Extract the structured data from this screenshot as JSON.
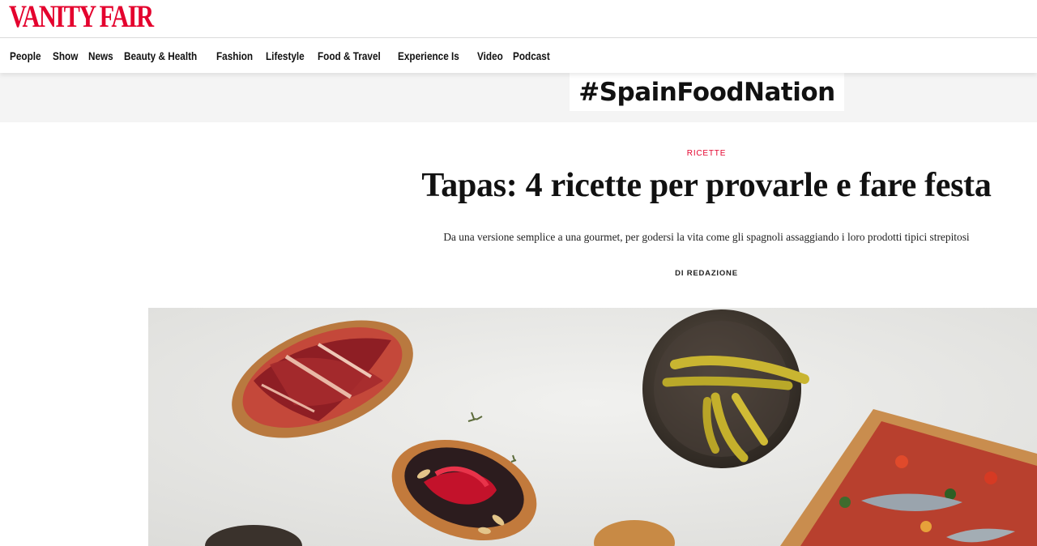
{
  "header": {
    "logo_text": "VANITY FAIR",
    "brand_color": "#e4032e"
  },
  "nav": {
    "items": [
      {
        "label": "People"
      },
      {
        "label": "Show"
      },
      {
        "label": "News"
      },
      {
        "label": "Beauty & Health"
      },
      {
        "label": "Fashion"
      },
      {
        "label": "Lifestyle"
      },
      {
        "label": "Food & Travel"
      },
      {
        "label": "Experience Is"
      },
      {
        "label": "Video"
      },
      {
        "label": "Podcast"
      }
    ]
  },
  "banner": {
    "hashtag": "#SpainFoodNation"
  },
  "article": {
    "category": "RICETTE",
    "headline": "Tapas: 4 ricette per provarle e fare festa",
    "dek": "Da una versione semplice a una gourmet, per godersi la vita come gli spagnoli assaggiando i loro prodotti tipici strepitosi",
    "byline": "DI REDAZIONE"
  },
  "hero_image": {
    "subject": "tapas on light stone surface: ham crostino, pepper crostino, bowl of pickled peppers, flatbread with vegetables and sardines"
  }
}
